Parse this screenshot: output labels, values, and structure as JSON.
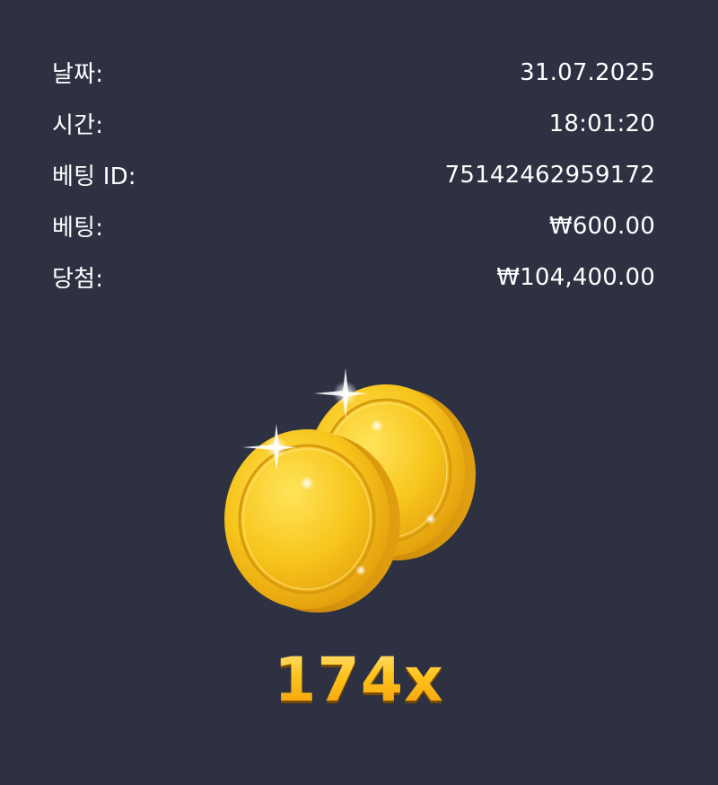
{
  "details": [
    {
      "label": "날짜:",
      "value": "31.07.2025"
    },
    {
      "label": "시간:",
      "value": "18:01:20"
    },
    {
      "label": "베팅 ID:",
      "value": "75142462959172"
    },
    {
      "label": "베팅:",
      "value": "₩600.00"
    },
    {
      "label": "당첨:",
      "value": "₩104,400.00"
    }
  ],
  "result": {
    "multiplier": "174x",
    "icon": "gold-coins-icon"
  },
  "colors": {
    "background": "#2d3142",
    "text": "#ffffff",
    "gold": "#ffc21a"
  }
}
